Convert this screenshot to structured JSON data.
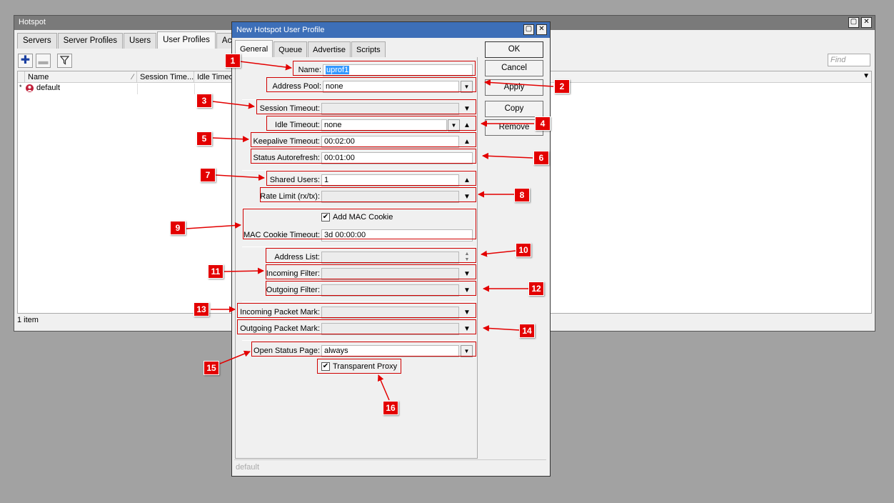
{
  "main_window": {
    "title": "Hotspot",
    "tabs": [
      "Servers",
      "Server Profiles",
      "Users",
      "User Profiles",
      "Active"
    ],
    "columns": [
      "Name",
      "Session Time...",
      "Idle Timeout"
    ],
    "rows": [
      {
        "marker": "*",
        "name": "default"
      }
    ],
    "find_placeholder": "Find",
    "status": "1 item"
  },
  "dialog": {
    "title": "New Hotspot User Profile",
    "tabs": [
      "General",
      "Queue",
      "Advertise",
      "Scripts"
    ],
    "buttons": {
      "ok": "OK",
      "cancel": "Cancel",
      "apply": "Apply",
      "copy": "Copy",
      "remove": "Remove"
    },
    "fields": {
      "name": {
        "label": "Name:",
        "value": "uprof1"
      },
      "address_pool": {
        "label": "Address Pool:",
        "value": "none"
      },
      "session_timeout": {
        "label": "Session Timeout:",
        "value": ""
      },
      "idle_timeout": {
        "label": "Idle Timeout:",
        "value": "none"
      },
      "keepalive_timeout": {
        "label": "Keepalive Timeout:",
        "value": "00:02:00"
      },
      "status_autorefresh": {
        "label": "Status Autorefresh:",
        "value": "00:01:00"
      },
      "shared_users": {
        "label": "Shared Users:",
        "value": "1"
      },
      "rate_limit": {
        "label": "Rate Limit (rx/tx):",
        "value": ""
      },
      "add_mac_cookie": {
        "label": "Add MAC Cookie",
        "checked": true
      },
      "mac_cookie_timeout": {
        "label": "MAC Cookie Timeout:",
        "value": "3d 00:00:00"
      },
      "address_list": {
        "label": "Address List:",
        "value": ""
      },
      "incoming_filter": {
        "label": "Incoming Filter:",
        "value": ""
      },
      "outgoing_filter": {
        "label": "Outgoing Filter:",
        "value": ""
      },
      "incoming_packet_mark": {
        "label": "Incoming Packet Mark:",
        "value": ""
      },
      "outgoing_packet_mark": {
        "label": "Outgoing Packet Mark:",
        "value": ""
      },
      "open_status_page": {
        "label": "Open Status Page:",
        "value": "always"
      },
      "transparent_proxy": {
        "label": "Transparent Proxy",
        "checked": true
      }
    },
    "status": "default"
  },
  "annotations": [
    "1",
    "2",
    "3",
    "4",
    "5",
    "6",
    "7",
    "8",
    "9",
    "10",
    "11",
    "12",
    "13",
    "14",
    "15",
    "16"
  ],
  "colors": {
    "annotation_red": "#e30000",
    "title_blue": "#3d6fb8"
  }
}
